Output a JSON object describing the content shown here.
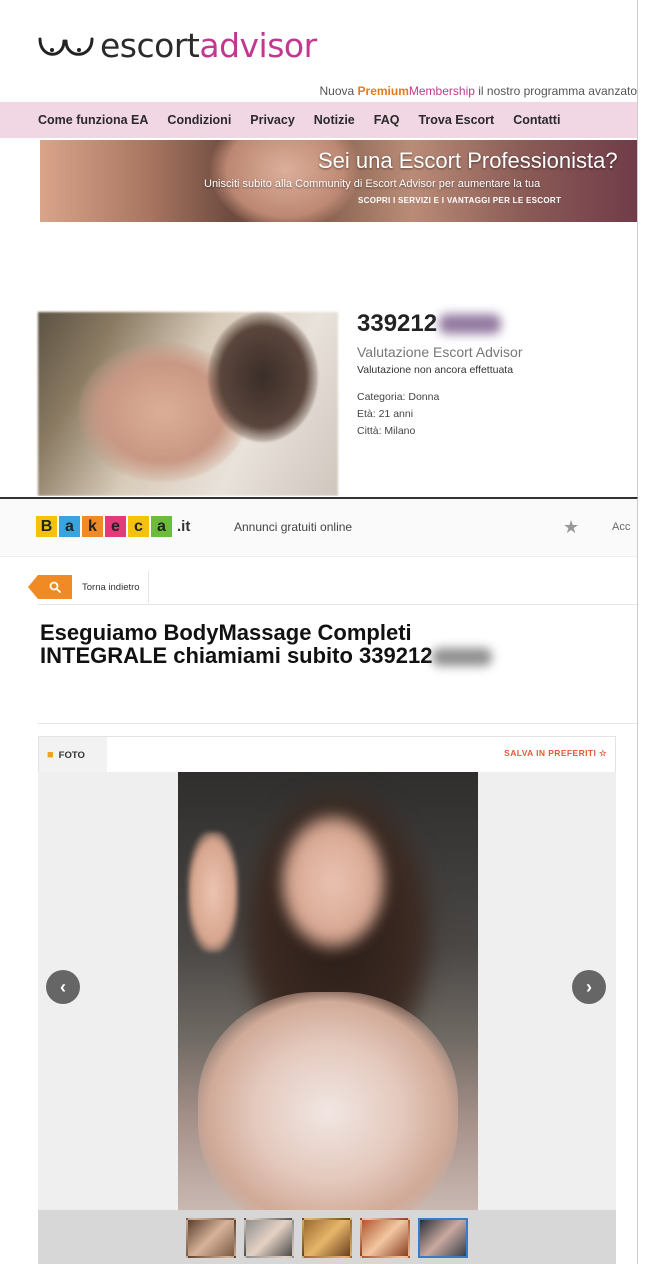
{
  "escortadvisor": {
    "logo": {
      "word1": "escort",
      "word2": "advisor"
    },
    "premium": {
      "prefix": "Nuova ",
      "premium": "Premium",
      "membership": "Membership",
      "suffix": " il nostro programma avanzato"
    },
    "nav": [
      "Come funziona EA",
      "Condizioni",
      "Privacy",
      "Notizie",
      "FAQ",
      "Trova Escort",
      "Contatti"
    ],
    "banner": {
      "title": "Sei una Escort Professionista?",
      "subtitle": "Unisciti subito alla Community di Escort Advisor per aumentare la tua",
      "cta": "SCOPRI I SERVIZI E I VANTAGGI PER LE ESCORT"
    },
    "profile": {
      "phone_visible": "339212",
      "rating_title": "Valutazione Escort Advisor",
      "rating_status": "Valutazione non ancora effettuata",
      "category": "Categoria: Donna",
      "age": "Età: 21 anni",
      "city": "Città: Milano"
    }
  },
  "bakeca": {
    "logo_letters": [
      "B",
      "a",
      "k",
      "e",
      "c",
      "a"
    ],
    "logo_colors": [
      "#f4c20d",
      "#3aa4dc",
      "#f08a24",
      "#e23a7a",
      "#f4c20d",
      "#6dbb3a"
    ],
    "logo_tld": ".it",
    "tagline": "Annunci gratuiti online",
    "account_label": "Acc",
    "back_label": "Torna indietro",
    "title_line1": "Eseguiamo BodyMassage Completi",
    "title_line2": "INTEGRALE chiamiami subito 339212",
    "foto_tab": "FOTO",
    "save_label": "SALVA IN PREFERITI ☆",
    "thumbnails": 5,
    "selected_thumbnail": 5
  }
}
